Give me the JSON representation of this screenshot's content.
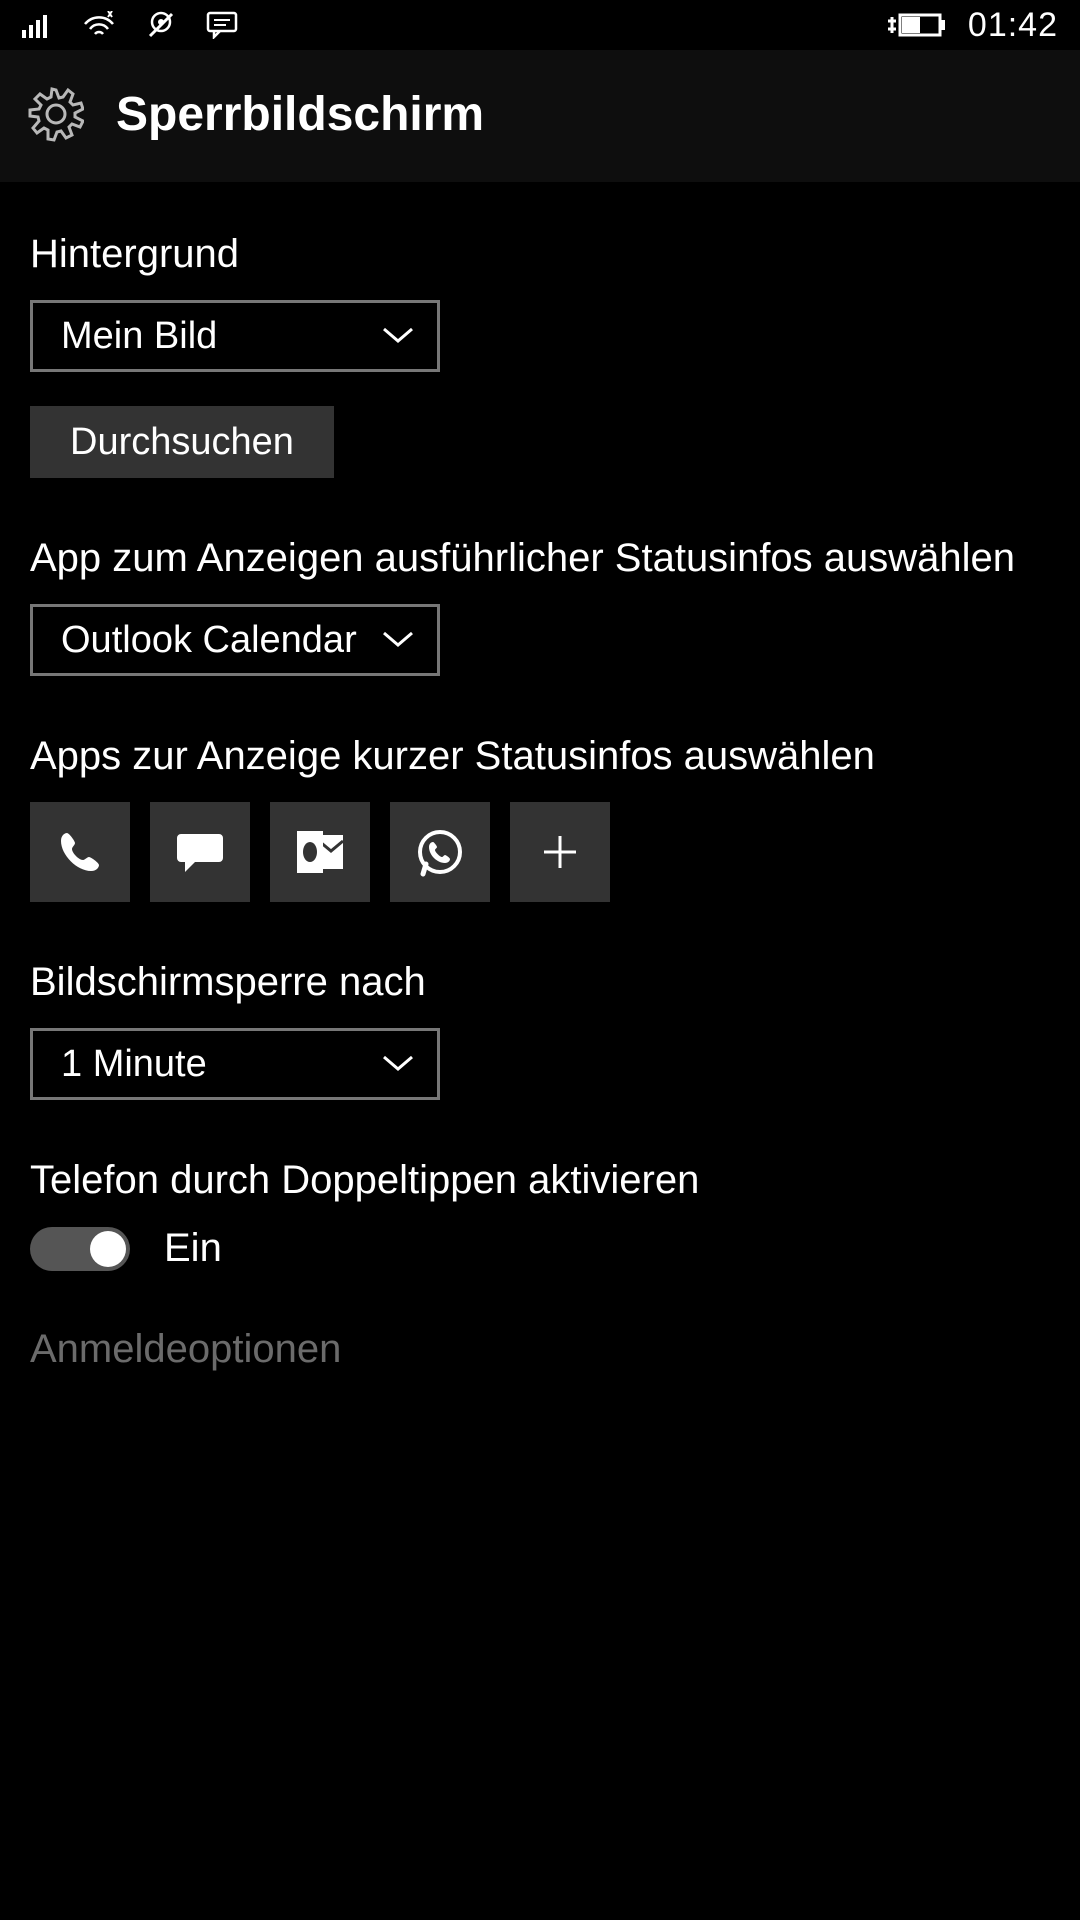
{
  "statusbar": {
    "time": "01:42"
  },
  "header": {
    "title": "Sperrbildschirm"
  },
  "background": {
    "label": "Hintergrund",
    "value": "Mein Bild",
    "browse": "Durchsuchen"
  },
  "detailed": {
    "label": "App zum Anzeigen ausführlicher Statusinfos auswählen",
    "value": "Outlook Calendar"
  },
  "quick": {
    "label": "Apps zur Anzeige kurzer Statusinfos auswählen",
    "apps": [
      "phone",
      "messaging",
      "outlook",
      "whatsapp",
      "add"
    ]
  },
  "timeout": {
    "label": "Bildschirmsperre nach",
    "value": "1 Minute"
  },
  "doubletap": {
    "label": "Telefon durch Doppeltippen aktivieren",
    "state": "Ein"
  },
  "signin_link": "Anmeldeoptionen"
}
